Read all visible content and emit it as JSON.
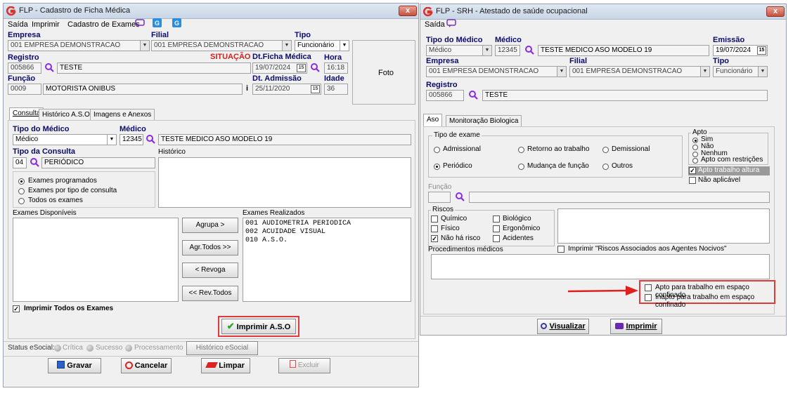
{
  "left": {
    "title": "FLP - Cadastro de Ficha Médica",
    "close": "x",
    "menu": [
      "Saída",
      "Imprimir",
      "Cadastro de Exames"
    ],
    "labels": {
      "empresa": "Empresa",
      "filial": "Filial",
      "tipo": "Tipo",
      "registro": "Registro",
      "situacao": "SITUAÇÃO",
      "dt_ficha": "Dt.Ficha Médica",
      "hora": "Hora",
      "funcao": "Função",
      "dt_admissao": "Dt. Admissão",
      "idade": "Idade",
      "foto": "Foto"
    },
    "values": {
      "empresa": "001 EMPRESA DEMONSTRACAO",
      "filial": "001 EMPRESA DEMONSTRACAO",
      "tipo": "Funcionário",
      "registro_code": "005866",
      "registro_name": "TESTE",
      "dt_ficha": "19/07/2024",
      "hora": "16:18",
      "funcao_code": "0009",
      "funcao_name": "MOTORISTA ONIBUS",
      "dt_admissao": "25/11/2020",
      "idade": "36",
      "info": "i"
    },
    "tabs": [
      "Consulta",
      "Histórico A.S.O.",
      "Imagens e Anexos"
    ],
    "consulta": {
      "tipo_medico_label": "Tipo do Médico",
      "tipo_medico": "Médico",
      "medico_label": "Médico",
      "medico_code": "12345",
      "medico_name": "TESTE MEDICO ASO MODELO 19",
      "tipo_consulta_label": "Tipo da Consulta",
      "tipo_consulta_code": "04",
      "tipo_consulta_name": "PERIÓDICO",
      "historico_label": "Histórico",
      "radios": [
        "Exames programados",
        "Exames por tipo de consulta",
        "Todos os exames"
      ],
      "disp_label": "Exames Disponíveis",
      "real_label": "Exames Realizados",
      "realizados": [
        "001 AUDIOMETRIA PERIODICA",
        "002 ACUIDADE VISUAL",
        "010 A.S.O."
      ],
      "btn_agrupa": "Agrupa >",
      "btn_agr_todos": "Agr.Todos >>",
      "btn_revoga": "< Revoga",
      "btn_rev_todos": "<< Rev.Todos",
      "imprimir_todos": "Imprimir Todos os Exames",
      "imprimir_aso": "Imprimir A.S.O"
    },
    "status": {
      "label": "Status eSocial:",
      "items": [
        "Crítica",
        "Sucesso",
        "Processamento"
      ],
      "historico": "Histórico eSocial"
    },
    "bottom": {
      "gravar": "Gravar",
      "cancelar": "Cancelar",
      "limpar": "Limpar",
      "excluir": "Excluir"
    }
  },
  "right": {
    "title": "FLP - SRH - Atestado de saúde ocupacional",
    "close": "x",
    "menu": [
      "Saída"
    ],
    "labels": {
      "tipo_medico": "Tipo do Médico",
      "medico": "Médico",
      "emissao": "Emissão",
      "empresa": "Empresa",
      "filial": "Filial",
      "tipo": "Tipo",
      "registro": "Registro"
    },
    "values": {
      "tipo_medico": "Médico",
      "medico_code": "12345",
      "medico_name": "TESTE MEDICO ASO MODELO 19",
      "emissao": "19/07/2024",
      "empresa": "001 EMPRESA DEMONSTRACAO",
      "filial": "001 EMPRESA DEMONSTRACAO",
      "tipo": "Funcionário",
      "registro_code": "005866",
      "registro_name": "TESTE"
    },
    "tabs": [
      "Aso",
      "Monitoração Biologica"
    ],
    "aso": {
      "tipo_exame_label": "Tipo de exame",
      "exames": [
        "Admissional",
        "Retorno ao trabalho",
        "Demissional",
        "Periódico",
        "Mudança de função",
        "Outros"
      ],
      "apto_label": "Apto",
      "apto": [
        "Sim",
        "Não",
        "Nenhum",
        "Apto com restrições"
      ],
      "apto_altura": "Apto trabalho altura",
      "nao_aplicavel": "Não aplicável",
      "funcao_label": "Função",
      "riscos_label": "Riscos",
      "riscos": [
        "Químico",
        "Biológico",
        "Físico",
        "Ergonômico",
        "Não há risco",
        "Acidentes"
      ],
      "imprimir_riscos": "Imprimir  \"Riscos Associados aos Agentes Nocivos\"",
      "procedimentos_label": "Procedimentos médicos",
      "confinado_apto": "Apto para trabalho em espaço confinado",
      "confinado_inapto": "Inapto para trabalho em espaço confinado"
    },
    "bottom": {
      "visualizar": "Visualizar",
      "imprimir": "Imprimir"
    }
  },
  "colors": {
    "accent": "#d9332a",
    "label_blue": "#0a0a6a",
    "arrow": "#e0201c",
    "situacao": "#d0201c"
  }
}
